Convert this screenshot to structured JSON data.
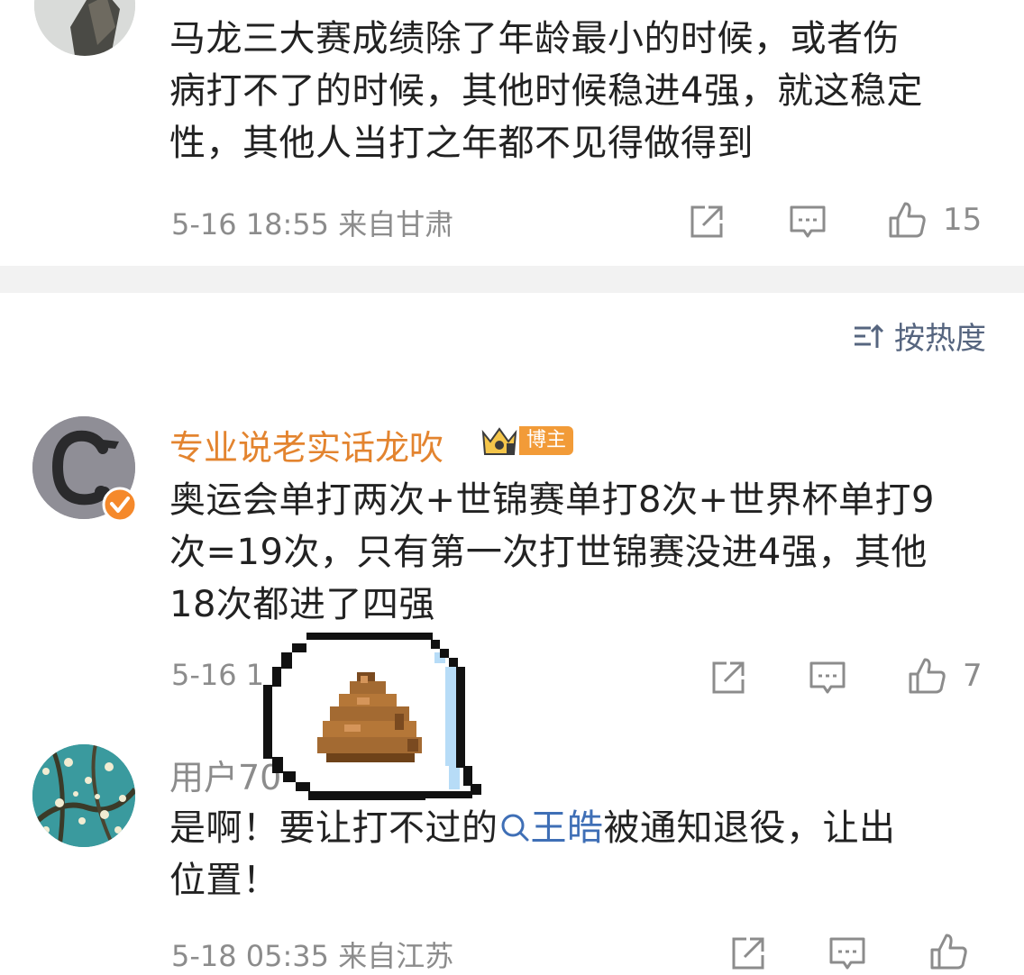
{
  "comments": [
    {
      "text": "马龙三大赛成绩除了年龄最小的时候，或者伤病打不了的时候，其他时候稳进4强，就这稳定性，其他人当打之年都不见得做得到",
      "lines": [
        "马龙三大赛成绩除了年龄最小的时候，或者伤",
        "病打不了的时候，其他时候稳进4强，就这稳定",
        "性，其他人当打之年都不见得做得到"
      ],
      "time": "5-16 18:55",
      "location": "来自甘肃",
      "likes": "15"
    },
    {
      "username": "专业说老实话龙吹",
      "badge": "博主",
      "lines": [
        "奥运会单打两次+世锦赛单打8次+世界杯单打9",
        "次=19次，只有第一次打世锦赛没进4强，其他",
        "18次都进了四强"
      ],
      "time": "5-16 1",
      "likes": "7"
    },
    {
      "username": "用户70",
      "text_before": "是啊！要让打不过的",
      "mention": "王皓",
      "text_after": "被通知退役，让出",
      "line2": "位置！",
      "time": "5-18 05:35",
      "location": "来自江苏"
    }
  ],
  "sort": {
    "label": "按热度"
  },
  "colors": {
    "username": "#e3842f",
    "meta": "#8c8c8c",
    "mention": "#3f6fb6",
    "badge": "#f29b38"
  },
  "icons": [
    "share-icon",
    "comment-icon",
    "like-icon",
    "sort-icon",
    "verified-icon",
    "crown-icon",
    "search-mention-icon",
    "poop-sticker"
  ]
}
